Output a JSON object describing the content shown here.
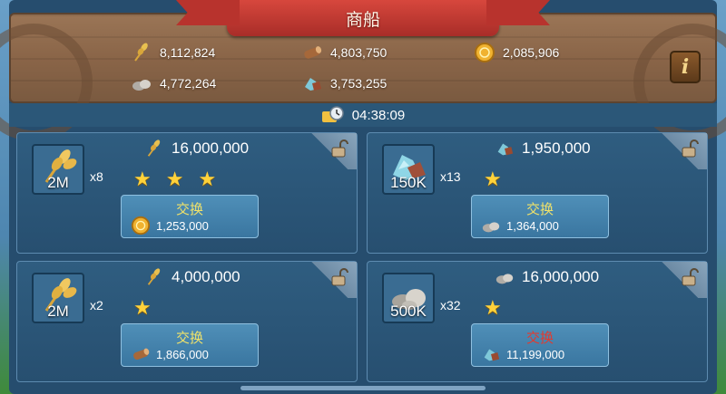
{
  "header": {
    "title": "商船",
    "info_label": "i",
    "resources": [
      {
        "name": "food",
        "icon": "wheat-icon",
        "value": "8,112,824"
      },
      {
        "name": "wood",
        "icon": "log-icon",
        "value": "4,803,750"
      },
      {
        "name": "gold",
        "icon": "gold-coin-icon",
        "value": "2,085,906"
      },
      {
        "name": "stone",
        "icon": "stone-icon",
        "value": "4,772,264"
      },
      {
        "name": "ore",
        "icon": "ore-icon",
        "value": "3,753,255"
      }
    ]
  },
  "timer": {
    "icon": "clock-icon",
    "value": "04:38:09"
  },
  "offers": [
    {
      "item_icon": "wheat-icon",
      "item_qty": "2M",
      "multiplier": "x8",
      "cost_icon": "wheat-icon",
      "cost_value": "16,000,000",
      "stars": 3,
      "button": {
        "label": "交换",
        "label_color": "#f0e26a",
        "price_icon": "gold-coin-icon",
        "price": "1,253,000"
      }
    },
    {
      "item_icon": "ore-icon",
      "item_qty": "150K",
      "multiplier": "x13",
      "cost_icon": "ore-icon",
      "cost_value": "1,950,000",
      "stars": 1,
      "button": {
        "label": "交换",
        "label_color": "#f0e26a",
        "price_icon": "stone-icon",
        "price": "1,364,000"
      }
    },
    {
      "item_icon": "wheat-icon",
      "item_qty": "2M",
      "multiplier": "x2",
      "cost_icon": "wheat-icon",
      "cost_value": "4,000,000",
      "stars": 1,
      "button": {
        "label": "交换",
        "label_color": "#f0e26a",
        "price_icon": "log-icon",
        "price": "1,866,000"
      }
    },
    {
      "item_icon": "stone-icon",
      "item_qty": "500K",
      "multiplier": "x32",
      "cost_icon": "stone-icon",
      "cost_value": "16,000,000",
      "stars": 1,
      "button": {
        "label": "交换",
        "label_color": "#e23a2e",
        "price_icon": "ore-icon",
        "price": "11,199,000"
      }
    }
  ]
}
